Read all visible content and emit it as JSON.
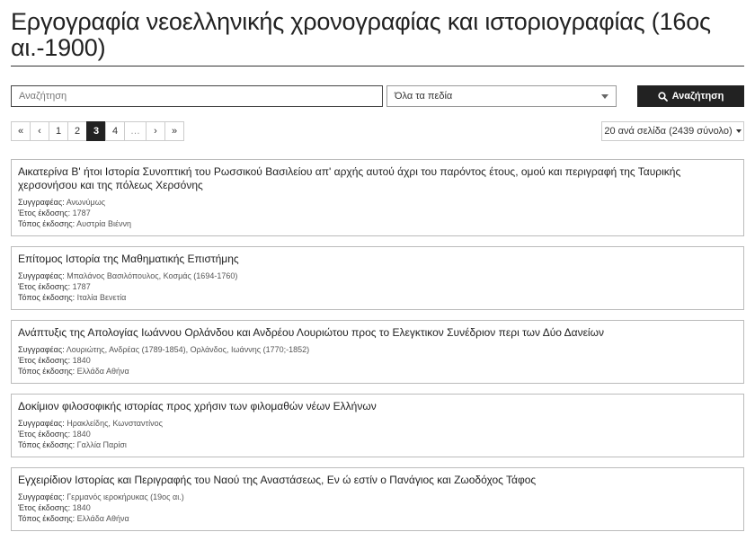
{
  "header": {
    "title": "Εργογραφία νεοελληνικής χρονογραφίας και ιστοριογραφίας (16ος αι.-1900)"
  },
  "search": {
    "placeholder": "Αναζήτηση",
    "field_selected": "Όλα τα πεδία",
    "button_label": "Αναζήτηση"
  },
  "pagination": {
    "items": [
      "«",
      "‹",
      "1",
      "2",
      "3",
      "4",
      "…",
      "›",
      "»"
    ],
    "current": "3"
  },
  "per_page": {
    "label": "20 ανά σελίδα (2439 σύνολο)"
  },
  "labels": {
    "author": "Συγγραφέας:",
    "year": "Έτος έκδοσης:",
    "place": "Τόπος έκδοσης:"
  },
  "results": [
    {
      "title": "Αικατερίνα Β' ήτοι Ιστορία Συνοπτική του Ρωσσικού Βασιλείου απ' αρχής αυτού άχρι του παρόντος έτους, ομού και περιγραφή της Ταυρικής χερσονήσου και της πόλεως Χερσόνης",
      "author": "Ανωνύμως",
      "year": "1787",
      "place": "Αυστρία Βιέννη"
    },
    {
      "title": "Επίτομος Ιστορία της Μαθηματικής Επιστήμης",
      "author": "Μπαλάνος Βασιλόπουλος, Κοσμάς (1694-1760)",
      "year": "1787",
      "place": "Ιταλία Βενετία"
    },
    {
      "title": "Ανάπτυξις της Απολογίας Ιωάννου Ορλάνδου και Ανδρέου Λουριώτου προς το Ελεγκτικον Συνέδριον περι των Δύο Δανείων",
      "author": "Λουριώτης, Ανδρέας (1789-1854), Ορλάνδος, Ιωάννης (1770;-1852)",
      "year": "1840",
      "place": "Ελλάδα Αθήνα"
    },
    {
      "title": "Δοκίμιον φιλοσοφικής ιστορίας προς χρήσιν των φιλομαθών νέων Ελλήνων",
      "author": "Ηρακλείδης, Κωνσταντίνος",
      "year": "1840",
      "place": "Γαλλία Παρίσι"
    },
    {
      "title": "Εγχειρίδιον Ιστορίας και Περιγραφής του Ναού της Αναστάσεως, Εν ώ εστίν ο Πανάγιος και Ζωοδόχος Τάφος",
      "author": "Γερμανός ιεροκήρυκας (19ος αι.)",
      "year": "1840",
      "place": "Ελλάδα Αθήνα"
    }
  ]
}
